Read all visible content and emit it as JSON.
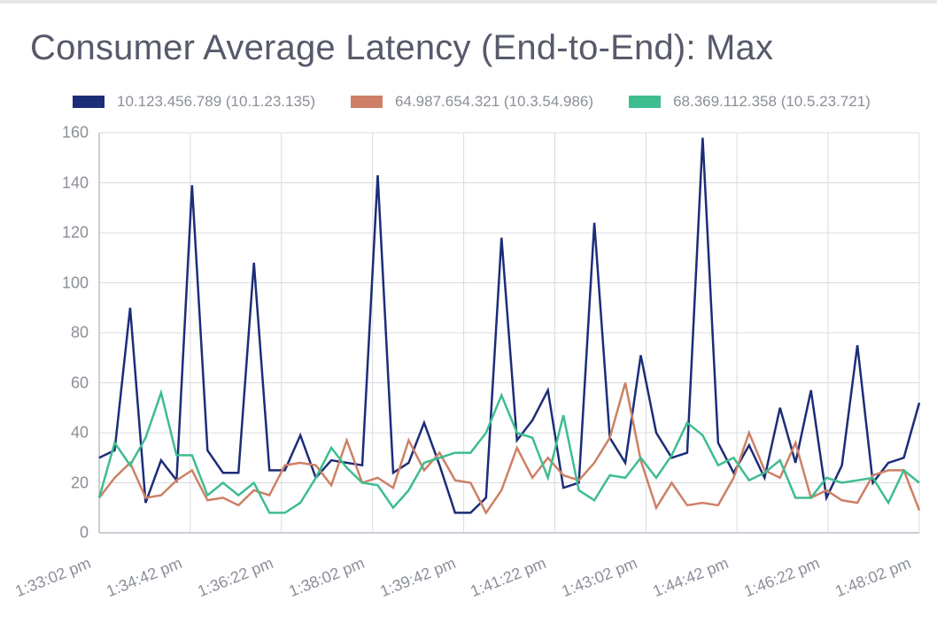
{
  "title": "Consumer Average Latency (End-to-End): Max",
  "legend": [
    {
      "label": "10.123.456.789 (10.1.23.135)",
      "color": "#1c2d78"
    },
    {
      "label": "64.987.654.321 (10.3.54.986)",
      "color": "#cd8066"
    },
    {
      "label": "68.369.112.358 (10.5.23.721)",
      "color": "#3ebd8f"
    }
  ],
  "chart_data": {
    "type": "line",
    "title": "Consumer Average Latency (End-to-End): Max",
    "xlabel": "",
    "ylabel": "",
    "ylim": [
      0,
      160
    ],
    "x_tick_labels": [
      "1:33:02 pm",
      "1:34:42 pm",
      "1:36:22 pm",
      "1:38:02 pm",
      "1:39:42 pm",
      "1:41:22 pm",
      "1:43:02 pm",
      "1:44:42 pm",
      "1:46:22 pm",
      "1:48:02 pm"
    ],
    "y_tick_labels": [
      0,
      20,
      40,
      60,
      80,
      100,
      120,
      140,
      160
    ],
    "series": [
      {
        "name": "10.123.456.789 (10.1.23.135)",
        "color": "#1c2d78",
        "values": [
          30,
          33,
          90,
          12,
          29,
          21,
          139,
          33,
          24,
          24,
          108,
          25,
          25,
          39,
          22,
          29,
          28,
          27,
          143,
          24,
          28,
          44,
          27,
          8,
          8,
          14,
          118,
          37,
          45,
          57,
          18,
          20,
          124,
          38,
          28,
          71,
          40,
          30,
          32,
          158,
          36,
          24,
          35,
          22,
          50,
          28,
          57,
          14,
          27,
          75,
          20,
          28,
          30,
          52
        ]
      },
      {
        "name": "64.987.654.321 (10.3.54.986)",
        "color": "#cd8066",
        "values": [
          14,
          22,
          28,
          14,
          15,
          21,
          25,
          13,
          14,
          11,
          17,
          15,
          27,
          28,
          27,
          19,
          37,
          20,
          22,
          18,
          37,
          25,
          32,
          21,
          20,
          8,
          17,
          34,
          22,
          30,
          23,
          21,
          28,
          38,
          60,
          29,
          10,
          20,
          11,
          12,
          11,
          22,
          40,
          25,
          22,
          36,
          14,
          17,
          13,
          12,
          23,
          25,
          25,
          9
        ]
      },
      {
        "name": "68.369.112.358 (10.5.23.721)",
        "color": "#3ebd8f",
        "values": [
          14,
          36,
          27,
          38,
          56,
          31,
          31,
          15,
          20,
          15,
          20,
          8,
          8,
          12,
          22,
          34,
          26,
          20,
          19,
          10,
          17,
          28,
          30,
          32,
          32,
          40,
          55,
          40,
          38,
          22,
          47,
          17,
          13,
          23,
          22,
          30,
          22,
          31,
          44,
          39,
          27,
          30,
          21,
          24,
          29,
          14,
          14,
          22,
          20,
          21,
          22,
          12,
          25,
          20
        ]
      }
    ]
  }
}
